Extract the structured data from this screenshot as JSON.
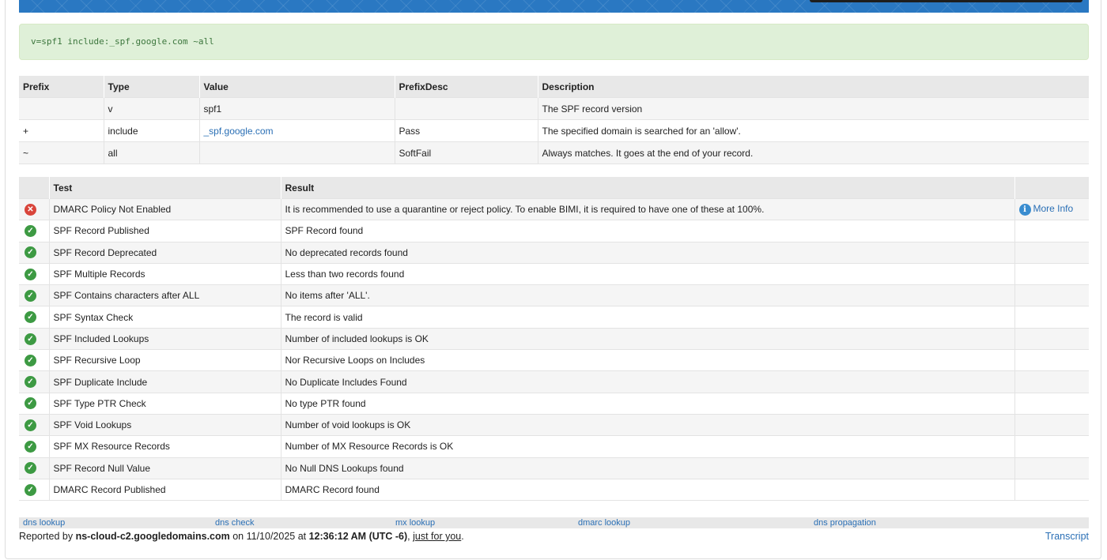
{
  "record": "v=spf1 include:_spf.google.com ~all",
  "spf_table": {
    "headers": [
      "Prefix",
      "Type",
      "Value",
      "PrefixDesc",
      "Description"
    ],
    "rows": [
      {
        "prefix": "",
        "type": "v",
        "value": "spf1",
        "prefix_desc": "",
        "description": "The SPF record version"
      },
      {
        "prefix": "+",
        "type": "include",
        "value": "_spf.google.com",
        "prefix_desc": "Pass",
        "description": "The specified domain is searched for an 'allow'."
      },
      {
        "prefix": "~",
        "type": "all",
        "value": "",
        "prefix_desc": "SoftFail",
        "description": "Always matches. It goes at the end of your record."
      }
    ]
  },
  "test_table": {
    "headers": [
      "",
      "Test",
      "Result",
      ""
    ],
    "more_info_label": "More Info",
    "rows": [
      {
        "status": "error",
        "test": "DMARC Policy Not Enabled",
        "result": "It is recommended to use a quarantine or reject policy. To enable BIMI, it is required to have one of these at 100%."
      },
      {
        "status": "ok",
        "test": "SPF Record Published",
        "result": "SPF Record found"
      },
      {
        "status": "ok",
        "test": "SPF Record Deprecated",
        "result": "No deprecated records found"
      },
      {
        "status": "ok",
        "test": "SPF Multiple Records",
        "result": "Less than two records found"
      },
      {
        "status": "ok",
        "test": "SPF Contains characters after ALL",
        "result": "No items after 'ALL'."
      },
      {
        "status": "ok",
        "test": "SPF Syntax Check",
        "result": "The record is valid"
      },
      {
        "status": "ok",
        "test": "SPF Included Lookups",
        "result": "Number of included lookups is OK"
      },
      {
        "status": "ok",
        "test": "SPF Recursive Loop",
        "result": "Nor Recursive Loops on Includes"
      },
      {
        "status": "ok",
        "test": "SPF Duplicate Include",
        "result": "No Duplicate Includes Found"
      },
      {
        "status": "ok",
        "test": "SPF Type PTR Check",
        "result": "No type PTR found"
      },
      {
        "status": "ok",
        "test": "SPF Void Lookups",
        "result": "Number of void lookups is OK"
      },
      {
        "status": "ok",
        "test": "SPF MX Resource Records",
        "result": "Number of MX Resource Records is OK"
      },
      {
        "status": "ok",
        "test": "SPF Record Null Value",
        "result": "No Null DNS Lookups found"
      },
      {
        "status": "ok",
        "test": "DMARC Record Published",
        "result": "DMARC Record found"
      }
    ]
  },
  "footer_links": [
    "dns lookup",
    "dns check",
    "mx lookup",
    "dmarc lookup",
    "dns propagation"
  ],
  "reported": {
    "prefix": "Reported by ",
    "server": "ns-cloud-c2.googledomains.com",
    "on": " on 11/10/2025 at ",
    "time": "12:36:12 AM (UTC -6)",
    "sep": ", ",
    "just_for_you": "just for you",
    "end": "."
  },
  "transcript_label": "Transcript",
  "icons": {
    "ok": "check-circle",
    "error": "x-circle",
    "info": "info-circle"
  },
  "colors": {
    "ok": "#3d9a43",
    "error": "#d9453b",
    "link": "#2a6fb5",
    "record_bg": "#dff0d8",
    "record_text": "#3c763d",
    "banner": "#2a78c2"
  }
}
